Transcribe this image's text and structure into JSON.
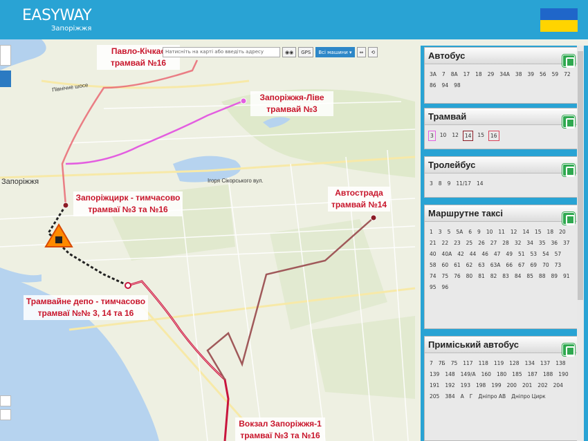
{
  "header": {
    "logo_text": "EASYWAY",
    "city": "Запоріжжя",
    "flag_colors": [
      "#1f66c9",
      "#ffd400"
    ]
  },
  "toolbar": {
    "search_placeholder": "Натисніть на карті або введіть адресу",
    "gps_label": "GPS",
    "vehicles_label": "Всі машини"
  },
  "map": {
    "labels": {
      "pavlo": "Павло-Кічкас трамвай №16",
      "livy": "Запоріжжя-Ліве трамвай №3",
      "circus": "Запоріжцирк - тимчасово трамваї №3 та №16",
      "autostrada": "Автострада трамвай №14",
      "depot": "Трамвайне депо - тимчасово трамваї №№ 3, 14 та 16",
      "vokzal": "Вокзал Запоріжжя-1 трамваї №3 та №16"
    },
    "places": {
      "city": "Запоріжжя",
      "street1": "Північне шосе",
      "street2": "Ігоря Сікорського вул."
    }
  },
  "colors": {
    "route3": "#e35ee0",
    "route14": "#a0595a",
    "route16": "#d9435a",
    "routeMain": "#c8153d",
    "accent": "#29a3d4"
  },
  "panel": {
    "sections": [
      {
        "title": "Автобус",
        "routes": [
          "3А",
          "7",
          "8А",
          "17",
          "18",
          "29",
          "34А",
          "38",
          "39",
          "56",
          "59",
          "72",
          "86",
          "94",
          "98"
        ]
      },
      {
        "title": "Трамвай",
        "routes": [
          "3",
          "10",
          "12",
          "14",
          "15",
          "16"
        ]
      },
      {
        "title": "Тролейбус",
        "routes": [
          "3",
          "8",
          "9",
          "11/17",
          "14"
        ]
      },
      {
        "title": "Маршрутне таксі",
        "routes": [
          "1",
          "3",
          "5",
          "5А",
          "6",
          "9",
          "10",
          "11",
          "12",
          "14",
          "15",
          "18",
          "20",
          "21",
          "22",
          "23",
          "25",
          "26",
          "27",
          "28",
          "32",
          "34",
          "35",
          "36",
          "37",
          "40",
          "40А",
          "42",
          "44",
          "46",
          "47",
          "49",
          "51",
          "53",
          "54",
          "57",
          "58",
          "60",
          "61",
          "62",
          "63",
          "63А",
          "66",
          "67",
          "69",
          "70",
          "73",
          "74",
          "75",
          "76",
          "80",
          "81",
          "82",
          "83",
          "84",
          "85",
          "88",
          "89",
          "91",
          "95",
          "96"
        ]
      },
      {
        "title": "Приміський автобус",
        "routes": [
          "7",
          "7Б",
          "75",
          "117",
          "118",
          "119",
          "128",
          "134",
          "137",
          "138",
          "139",
          "148",
          "149/А",
          "160",
          "180",
          "185",
          "187",
          "188",
          "190",
          "191",
          "192",
          "193",
          "198",
          "199",
          "200",
          "201",
          "202",
          "204",
          "205",
          "384",
          "А",
          "Г",
          "Дніпро АВ",
          "Дніпро Цирк"
        ]
      }
    ]
  }
}
